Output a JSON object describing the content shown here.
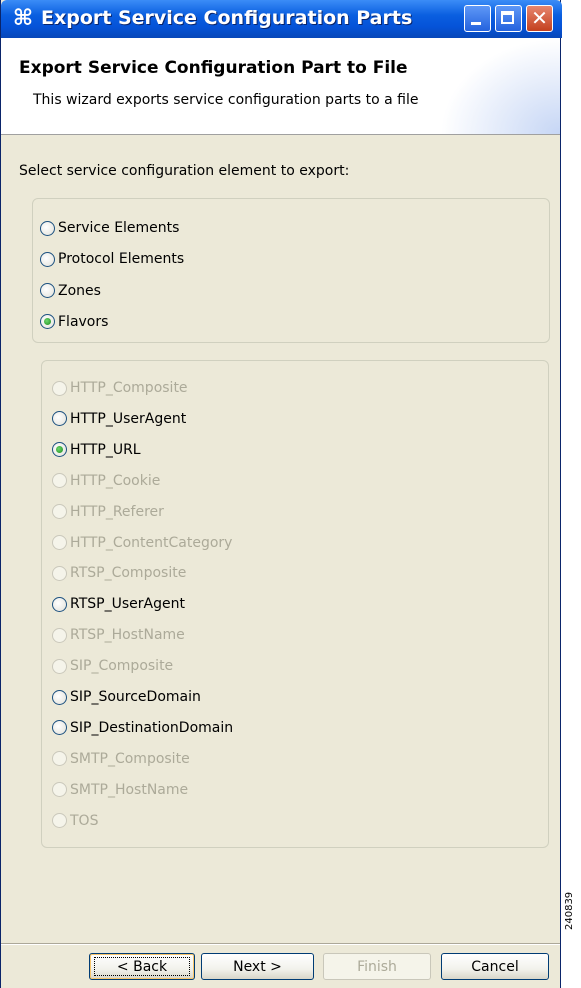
{
  "window": {
    "title": "Export Service Configuration Parts",
    "icon": "app-asterisk-icon",
    "icon_glyph": "⌘"
  },
  "header": {
    "title": "Export Service Configuration Part to File",
    "description": "This wizard exports service configuration parts to a file"
  },
  "prompt": "Select service configuration element to export:",
  "element_types": [
    {
      "label": "Service Elements",
      "checked": false,
      "enabled": true
    },
    {
      "label": "Protocol Elements",
      "checked": false,
      "enabled": true
    },
    {
      "label": "Zones",
      "checked": false,
      "enabled": true
    },
    {
      "label": "Flavors",
      "checked": true,
      "enabled": true
    }
  ],
  "flavors": [
    {
      "label": "HTTP_Composite",
      "checked": false,
      "enabled": false
    },
    {
      "label": "HTTP_UserAgent",
      "checked": false,
      "enabled": true
    },
    {
      "label": "HTTP_URL",
      "checked": true,
      "enabled": true
    },
    {
      "label": "HTTP_Cookie",
      "checked": false,
      "enabled": false
    },
    {
      "label": "HTTP_Referer",
      "checked": false,
      "enabled": false
    },
    {
      "label": "HTTP_ContentCategory",
      "checked": false,
      "enabled": false
    },
    {
      "label": "RTSP_Composite",
      "checked": false,
      "enabled": false
    },
    {
      "label": "RTSP_UserAgent",
      "checked": false,
      "enabled": true
    },
    {
      "label": "RTSP_HostName",
      "checked": false,
      "enabled": false
    },
    {
      "label": "SIP_Composite",
      "checked": false,
      "enabled": false
    },
    {
      "label": "SIP_SourceDomain",
      "checked": false,
      "enabled": true
    },
    {
      "label": "SIP_DestinationDomain",
      "checked": false,
      "enabled": true
    },
    {
      "label": "SMTP_Composite",
      "checked": false,
      "enabled": false
    },
    {
      "label": "SMTP_HostName",
      "checked": false,
      "enabled": false
    },
    {
      "label": "TOS",
      "checked": false,
      "enabled": false
    }
  ],
  "buttons": {
    "back": "< Back",
    "next": "Next >",
    "finish": "Finish",
    "cancel": "Cancel"
  },
  "side_label": "240839"
}
